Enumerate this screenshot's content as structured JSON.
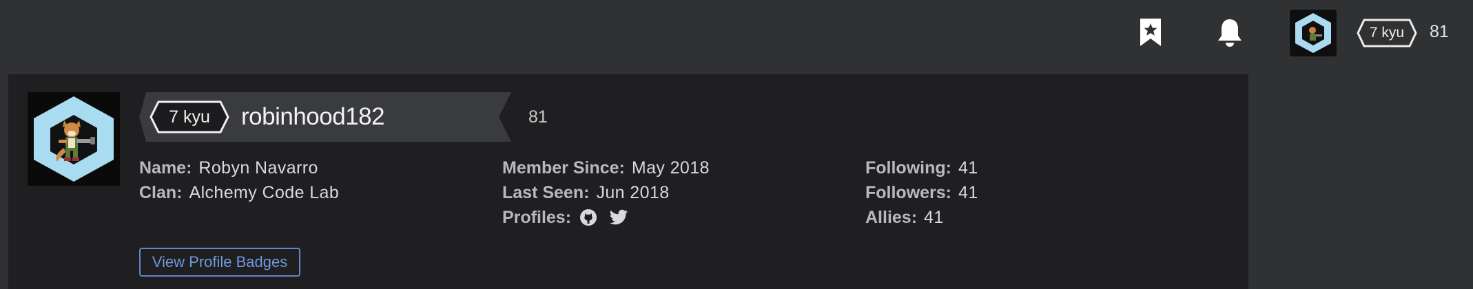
{
  "nav": {
    "bookmark_icon": "bookmark-star-icon",
    "bell_icon": "bell-icon",
    "rank": "7 kyu",
    "honor": "81"
  },
  "profile": {
    "rank": "7 kyu",
    "username": "robinhood182",
    "honor": "81",
    "stats_left": [
      {
        "label": "Name:",
        "value": "Robyn Navarro"
      },
      {
        "label": "Clan:",
        "value": "Alchemy Code Lab"
      }
    ],
    "stats_middle": [
      {
        "label": "Member Since:",
        "value": "May 2018"
      },
      {
        "label": "Last Seen:",
        "value": "Jun 2018"
      },
      {
        "label": "Profiles:",
        "icons": [
          "github-icon",
          "twitter-icon"
        ]
      }
    ],
    "stats_right": [
      {
        "label": "Following:",
        "value": "41"
      },
      {
        "label": "Followers:",
        "value": "41"
      },
      {
        "label": "Allies:",
        "value": "41"
      }
    ],
    "badges_button": "View Profile Badges"
  },
  "colors": {
    "page_bg": "#303133",
    "card_bg": "#1f1f21",
    "avatar_hex": "#a9dcf0",
    "link_blue": "#6f98dc"
  }
}
